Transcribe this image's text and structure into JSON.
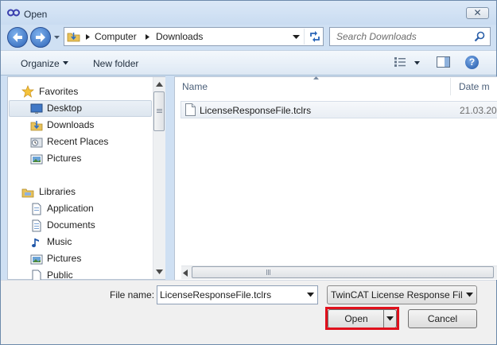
{
  "window": {
    "title": "Open",
    "close_glyph": "✕"
  },
  "address_bar": {
    "breadcrumbs": [
      "Computer",
      "Downloads"
    ]
  },
  "search": {
    "placeholder": "Search Downloads"
  },
  "toolbar": {
    "organize_label": "Organize",
    "new_folder_label": "New folder",
    "help_glyph": "?"
  },
  "nav_pane": {
    "favorites_header": "Favorites",
    "favorites": [
      {
        "label": "Desktop",
        "icon": "desktop-icon",
        "selected": true
      },
      {
        "label": "Downloads",
        "icon": "downloads-folder-icon"
      },
      {
        "label": "Recent Places",
        "icon": "recent-places-icon"
      },
      {
        "label": "Pictures",
        "icon": "pictures-icon"
      }
    ],
    "libraries_header": "Libraries",
    "libraries": [
      {
        "label": "Application",
        "icon": "document-icon"
      },
      {
        "label": "Documents",
        "icon": "documents-icon"
      },
      {
        "label": "Music",
        "icon": "music-icon"
      },
      {
        "label": "Pictures",
        "icon": "pictures-icon"
      },
      {
        "label": "Public",
        "icon": "document-icon"
      }
    ]
  },
  "file_list": {
    "columns": [
      "Name",
      "Date m"
    ],
    "rows": [
      {
        "name": "LicenseResponseFile.tclrs",
        "date": "21.03.20"
      }
    ]
  },
  "bottom": {
    "file_name_label": "File name:",
    "file_name_value": "LicenseResponseFile.tclrs",
    "file_type_value": "TwinCAT License Response File",
    "open_label": "Open",
    "cancel_label": "Cancel"
  },
  "colors": {
    "highlight": "#e0101c",
    "accent": "#2c63b6"
  }
}
